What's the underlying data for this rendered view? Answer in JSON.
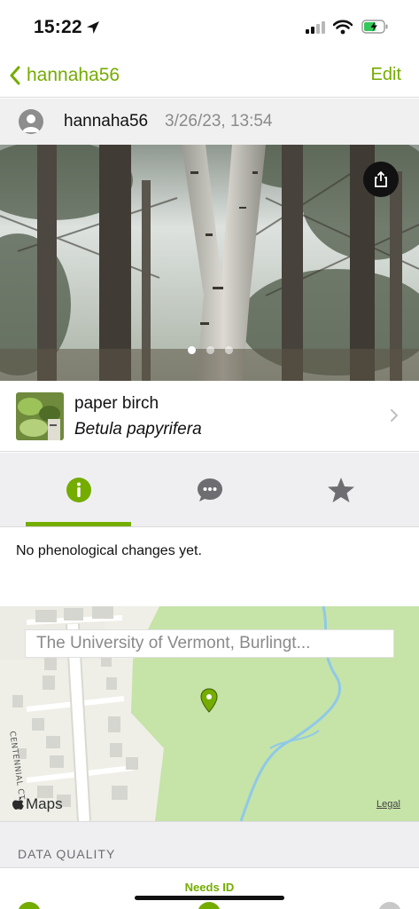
{
  "status_bar": {
    "time": "15:22"
  },
  "nav": {
    "back_label": "hannaha56",
    "edit_label": "Edit"
  },
  "observation": {
    "username": "hannaha56",
    "datetime": "3/26/23, 13:54"
  },
  "photo": {
    "page_count": 3,
    "current_page": 1
  },
  "taxon": {
    "common_name": "paper birch",
    "scientific_name": "Betula papyrifera"
  },
  "tabs": [
    {
      "name": "info",
      "icon": "info-icon",
      "selected": true
    },
    {
      "name": "activity",
      "icon": "chat-bubble-icon",
      "selected": false
    },
    {
      "name": "favorites",
      "icon": "star-icon",
      "selected": false
    }
  ],
  "info": {
    "phenology_text": "No phenological changes yet."
  },
  "map": {
    "place": "The University of Vermont, Burlingt...",
    "street_label": "CENTENNIAL CT",
    "attribution": "Maps",
    "legal_label": "Legal"
  },
  "data_quality": {
    "title": "DATA QUALITY",
    "grade_label": "Needs ID"
  },
  "colors": {
    "accent": "#74ac00",
    "map_green": "#c6e3a8"
  }
}
